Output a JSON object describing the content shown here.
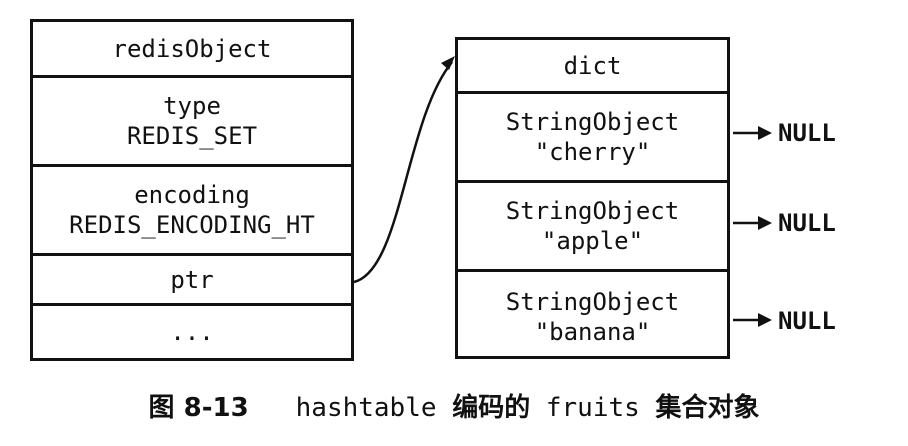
{
  "redis_object": {
    "title": "redisObject",
    "type_label": "type",
    "type_value": "REDIS_SET",
    "encoding_label": "encoding",
    "encoding_value": "REDIS_ENCODING_HT",
    "ptr_label": "ptr",
    "more_label": "..."
  },
  "dict": {
    "title": "dict",
    "entries": [
      {
        "type": "StringObject",
        "value": "\"cherry\"",
        "next": "NULL"
      },
      {
        "type": "StringObject",
        "value": "\"apple\"",
        "next": "NULL"
      },
      {
        "type": "StringObject",
        "value": "\"banana\"",
        "next": "NULL"
      }
    ]
  },
  "caption": {
    "figure": "图 8-13",
    "code1": "hashtable",
    "text1": "编码的",
    "code2": "fruits",
    "text2": "集合对象"
  },
  "colors": {
    "line": "#111111",
    "background": "#ffffff"
  }
}
